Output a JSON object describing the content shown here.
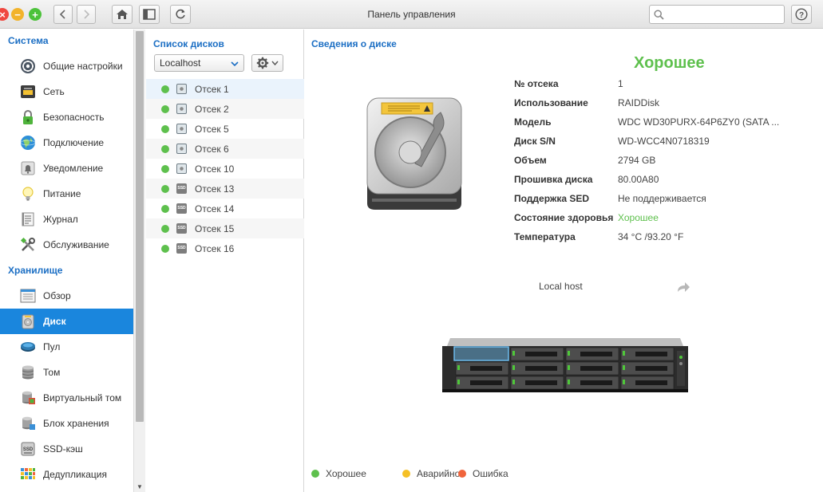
{
  "window": {
    "title": "Панель управления"
  },
  "search": {
    "placeholder": "",
    "value": ""
  },
  "colors": {
    "good": "#5ec04d",
    "warning": "#f5c026",
    "error": "#f0643c",
    "accent": "#1a86dd",
    "section": "#1c6fc4"
  },
  "sidebar": {
    "sections": [
      {
        "title": "Система",
        "items": [
          {
            "label": "Общие настройки",
            "icon": "gear-wheel-icon"
          },
          {
            "label": "Сеть",
            "icon": "network-icon"
          },
          {
            "label": "Безопасность",
            "icon": "lock-icon"
          },
          {
            "label": "Подключение",
            "icon": "globe-icon"
          },
          {
            "label": "Уведомление",
            "icon": "bell-icon"
          },
          {
            "label": "Питание",
            "icon": "bulb-icon"
          },
          {
            "label": "Журнал",
            "icon": "log-icon"
          },
          {
            "label": "Обслуживание",
            "icon": "tools-icon"
          }
        ]
      },
      {
        "title": "Хранилище",
        "items": [
          {
            "label": "Обзор",
            "icon": "overview-icon"
          },
          {
            "label": "Диск",
            "icon": "disk-icon",
            "active": true
          },
          {
            "label": "Пул",
            "icon": "pool-icon"
          },
          {
            "label": "Том",
            "icon": "volume-icon"
          },
          {
            "label": "Виртуальный том",
            "icon": "virtual-volume-icon"
          },
          {
            "label": "Блок хранения",
            "icon": "storage-block-icon"
          },
          {
            "label": "SSD-кэш",
            "icon": "ssd-cache-icon"
          },
          {
            "label": "Дедупликация",
            "icon": "dedup-icon"
          }
        ]
      }
    ]
  },
  "disk_list": {
    "title": "Список дисков",
    "location": "Localhost",
    "disks": [
      {
        "label": "Отсек 1",
        "type": "hdd",
        "status": "good",
        "selected": true
      },
      {
        "label": "Отсек 2",
        "type": "hdd",
        "status": "good"
      },
      {
        "label": "Отсек 5",
        "type": "hdd",
        "status": "good"
      },
      {
        "label": "Отсек 6",
        "type": "hdd",
        "status": "good"
      },
      {
        "label": "Отсек 10",
        "type": "hdd",
        "status": "good"
      },
      {
        "label": "Отсек 13",
        "type": "ssd",
        "status": "good",
        "icon_text": "SSD"
      },
      {
        "label": "Отсек 14",
        "type": "ssd",
        "status": "good",
        "icon_text": "SSD"
      },
      {
        "label": "Отсек 15",
        "type": "ssd",
        "status": "good",
        "icon_text": "SSD"
      },
      {
        "label": "Отсек 16",
        "type": "ssd",
        "status": "good",
        "icon_text": "SSD"
      }
    ]
  },
  "details": {
    "title": "Сведения о диске",
    "status": "Хорошее",
    "rows": [
      {
        "key": "№ отсека",
        "value": "1"
      },
      {
        "key": "Использование",
        "value": "RAIDDisk"
      },
      {
        "key": "Модель",
        "value": "WDC WD30PURX-64P6ZY0 (SATA ..."
      },
      {
        "key": "Диск S/N",
        "value": "WD-WCC4N0718319"
      },
      {
        "key": "Объем",
        "value": "2794 GB"
      },
      {
        "key": "Прошивка диска",
        "value": "80.00A80"
      },
      {
        "key": "Поддержка SED",
        "value": "Не поддерживается"
      },
      {
        "key": "Состояние здоровья",
        "value": "Хорошее",
        "good": true
      },
      {
        "key": "Температура",
        "value": "34 °C /93.20 °F"
      }
    ],
    "host_label": "Local host"
  },
  "legend": [
    {
      "label": "Хорошее",
      "color": "#5ec04d"
    },
    {
      "label": "Аварийное",
      "color": "#f5c026"
    },
    {
      "label": "Ошибка",
      "color": "#f0643c"
    }
  ]
}
